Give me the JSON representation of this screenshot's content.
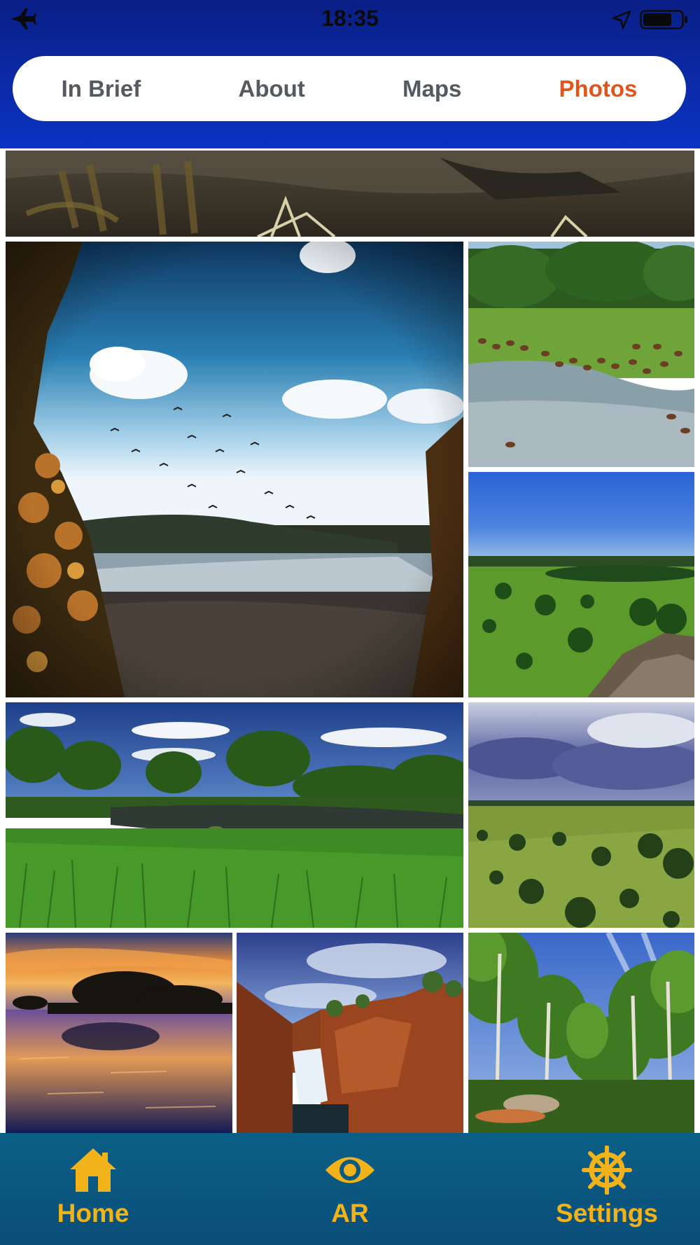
{
  "status_bar": {
    "time": "18:35",
    "airplane_mode_icon": "airplane-icon",
    "location_icon": "location-arrow-icon",
    "battery_icon": "battery-icon"
  },
  "segmented_tabs": {
    "items": [
      {
        "label": "In Brief",
        "active": false
      },
      {
        "label": "About",
        "active": false
      },
      {
        "label": "Maps",
        "active": false
      },
      {
        "label": "Photos",
        "active": true
      }
    ],
    "active_color": "#e0561a",
    "inactive_color": "#555a60"
  },
  "photos": [
    {
      "subject": "rock art ledge"
    },
    {
      "subject": "birds over river at sunset sky"
    },
    {
      "subject": "magpie geese on wetland"
    },
    {
      "subject": "blue sky over green savanna"
    },
    {
      "subject": "wetland lagoon with trees"
    },
    {
      "subject": "stormy clouds over grassland"
    },
    {
      "subject": "sunset over water with mangroves"
    },
    {
      "subject": "waterfall over red rocks"
    },
    {
      "subject": "paperbark forest"
    }
  ],
  "tabbar": {
    "items": [
      {
        "label": "Home",
        "icon": "home-icon"
      },
      {
        "label": "AR",
        "icon": "eye-icon"
      },
      {
        "label": "Settings",
        "icon": "ship-wheel-icon"
      }
    ],
    "color": "#f2b21a"
  }
}
